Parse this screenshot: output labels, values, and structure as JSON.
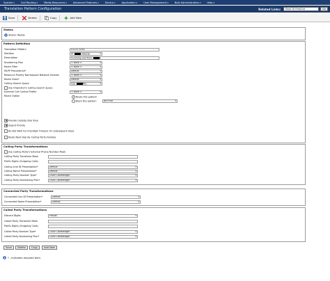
{
  "menubar": {
    "items": [
      "System",
      "Call Routing",
      "Media Resources",
      "Advanced Features",
      "Device",
      "Application",
      "User Management",
      "Bulk Administration",
      "Help"
    ]
  },
  "header": {
    "title": "Translation Pattern Configuration",
    "related_links_label": "Related Links:",
    "related_links_value": "Back To Find/List",
    "go_label": "Go"
  },
  "toolbar": {
    "save": "Save",
    "delete": "Delete",
    "copy": "Copy",
    "add_new": "Add New"
  },
  "status": {
    "title": "Status",
    "text": "Status: Ready"
  },
  "pattern_definition": {
    "title": "Pattern Definition",
    "translation_pattern_label": "Translation Pattern",
    "translation_pattern_value": "03225.3XXX",
    "partition_label": "Partition",
    "partition_prefix": "PT",
    "partition_suffix": "Internal",
    "description_label": "Description",
    "description_value": "Incoming Call From",
    "description_tail": "G",
    "numbering_plan_label": "Numbering Plan",
    "numbering_plan_value": "< None >",
    "route_filter_label": "Route Filter",
    "route_filter_value": "< None >",
    "mlpp_label": "MLPP Precedence",
    "mlpp_value": "Default",
    "resource_priority_label": "Resource Priority Namespace Network Domain",
    "resource_priority_value": "< None >",
    "route_class_label": "Route Class",
    "route_class_value": "Default",
    "css_label": "Calling Search Space",
    "css_prefix": "CSS",
    "css_suffix": "Rtu",
    "use_originator_css_label": "Use Originator's Calling Search Space",
    "external_call_control_label": "External Call Control Profile",
    "external_call_control_value": "< None >",
    "route_option_label": "Route Option",
    "route_this_pattern_label": "Route this pattern",
    "block_this_pattern_label": "Block this pattern",
    "block_reason_value": "No Error",
    "provide_outside_dial_tone_label": "Provide Outside Dial Tone",
    "urgent_priority_label": "Urgent Priority",
    "do_not_wait_label": "Do Not Wait For Interdigit Timeout On Subsequent Hops",
    "route_next_hop_label": "Route Next Hop By Calling Party Number"
  },
  "calling_party": {
    "title": "Calling Party Transformations",
    "use_external_mask_label": "Use Calling Party's External Phone Number Mask",
    "transform_mask_label": "Calling Party Transform Mask",
    "prefix_digits_label": "Prefix Digits (Outgoing Calls)",
    "line_id_label": "Calling Line ID Presentation",
    "line_id_value": "Default",
    "name_presentation_label": "Calling Name Presentation",
    "name_presentation_value": "Default",
    "number_type_label": "Calling Party Number Type",
    "number_type_value": "Cisco CallManager",
    "numbering_plan_label": "Calling Party Numbering Plan",
    "numbering_plan_value": "Cisco CallManager"
  },
  "connected_party": {
    "title": "Connected Party Transformations",
    "line_id_label": "Connected Line ID Presentation",
    "line_id_value": "Default",
    "name_label": "Connected Name Presentation",
    "name_value": "Default"
  },
  "called_party": {
    "title": "Called Party Transformations",
    "discard_digits_label": "Discard Digits",
    "discard_digits_value": "PreDot",
    "transform_mask_label": "Called Party Transform Mask",
    "prefix_digits_label": "Prefix Digits (Outgoing Calls)",
    "number_type_label": "Called Party Number Type",
    "number_type_value": "Cisco CallManager",
    "numbering_plan_label": "Called Party Numbering Plan",
    "numbering_plan_value": "Cisco CallManager"
  },
  "bottom": {
    "save": "Save",
    "delete": "Delete",
    "copy": "Copy",
    "add_new": "Add New",
    "required_note": "- indicates required item."
  },
  "colors": {
    "menubar": "#1f3f73",
    "titlebar": "#1b3a68",
    "info_icon": "#2a62c9",
    "delete_icon": "#cc1f1f",
    "save_icon": "#2f6db5"
  }
}
